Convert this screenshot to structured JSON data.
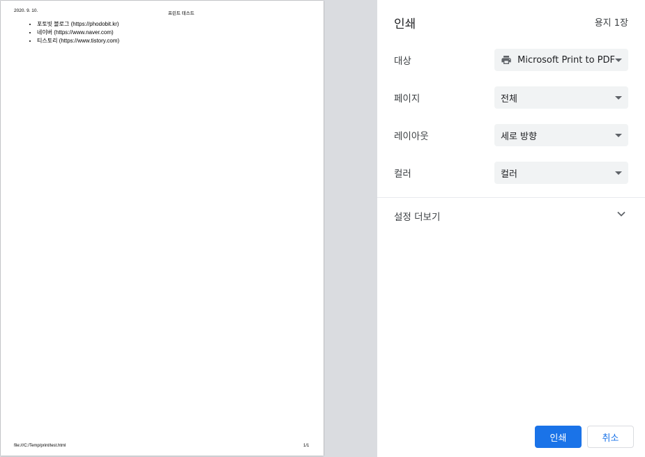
{
  "preview": {
    "header_date": "2020. 9. 10.",
    "header_title": "프린트 테스트",
    "list_items": [
      "포토빗 블로그 (https://phodobit.kr)",
      "네이버 (https://www.naver.com)",
      "티스토리 (https://www.tistory.com)"
    ],
    "footer_url": "file:///C:/Temp/print/test.html",
    "footer_page": "1/1"
  },
  "panel": {
    "title": "인쇄",
    "sheet_count": "용지 1장",
    "destination": {
      "label": "대상",
      "value": "Microsoft Print to PDF",
      "icon": "printer-icon"
    },
    "pages": {
      "label": "페이지",
      "value": "전체"
    },
    "layout": {
      "label": "레이아웃",
      "value": "세로 방향"
    },
    "color": {
      "label": "컬러",
      "value": "컬러"
    },
    "more_settings": "설정 더보기",
    "print_button": "인쇄",
    "cancel_button": "취소"
  },
  "colors": {
    "accent": "#1a73e8",
    "select_bg": "#f1f3f4",
    "preview_bg": "#dadce0"
  }
}
